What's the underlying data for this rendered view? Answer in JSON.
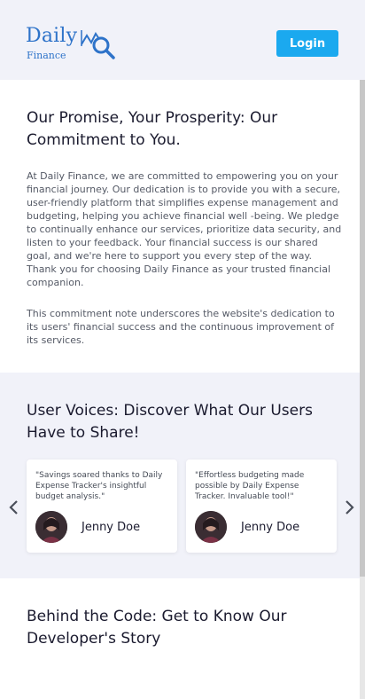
{
  "header": {
    "logo_main": "Daily",
    "logo_sub": "Finance",
    "login_label": "Login"
  },
  "promise": {
    "title": "Our Promise, Your Prosperity: Our Commitment to You.",
    "paragraph1": "At Daily Finance, we are committed to empowering you on your financial journey. Our dedication is to provide you with a secure, user-friendly platform that simplifies expense management and budgeting, helping you achieve financial well -being. We pledge to continually enhance our services, prioritize data security, and listen to your feedback. Your financial success is our shared goal, and we're here to support you every step of the way. Thank you for choosing Daily Finance as your trusted financial companion.",
    "paragraph2": "This commitment note underscores the website's dedication to its users' financial success and the continuous improvement of its services."
  },
  "voices": {
    "title": "User Voices: Discover What Our Users Have to Share!",
    "testimonials": [
      {
        "quote": "\"Savings soared thanks to Daily Expense Tracker's insightful budget analysis.\"",
        "name": "Jenny Doe"
      },
      {
        "quote": "\"Effortless budgeting made possible by Daily Expense Tracker. Invaluable tool!\"",
        "name": "Jenny Doe"
      }
    ]
  },
  "developer": {
    "title": "Behind the Code: Get to Know Our Developer's Story"
  },
  "icons": {
    "logo": "chart-magnifier-icon",
    "prev": "chevron-left-icon",
    "next": "chevron-right-icon"
  },
  "colors": {
    "brand": "#2e73c9",
    "button": "#1ba9ef",
    "section_bg": "#f1f2f9"
  }
}
